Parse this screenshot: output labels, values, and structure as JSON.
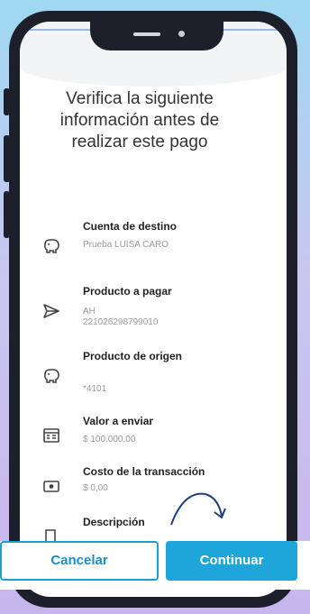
{
  "heading": {
    "line1": "Verifica la siguiente",
    "line2": "información antes de",
    "line3": "realizar este pago"
  },
  "items": [
    {
      "label": "Cuenta de destino",
      "value": "Prueba LUISA CARO",
      "icon": "piggy-bank-icon"
    },
    {
      "label": "Producto a pagar",
      "value": "AH",
      "value2": "221026298799010",
      "icon": "send-icon"
    },
    {
      "label": "Producto de origen",
      "value": "*4101",
      "icon": "piggy-bank-icon"
    },
    {
      "label": "Valor a enviar",
      "value": "$ 100.000,00",
      "icon": "receipt-icon"
    },
    {
      "label": "Costo de la transacción",
      "value": "$ 0,00",
      "icon": "money-icon"
    },
    {
      "label": "Descripción",
      "value": "",
      "icon": "document-icon"
    }
  ],
  "buttons": {
    "cancel": "Cancelar",
    "continue": "Continuar"
  },
  "colors": {
    "accent": "#1ea6da",
    "frame": "#1d1f2a"
  }
}
